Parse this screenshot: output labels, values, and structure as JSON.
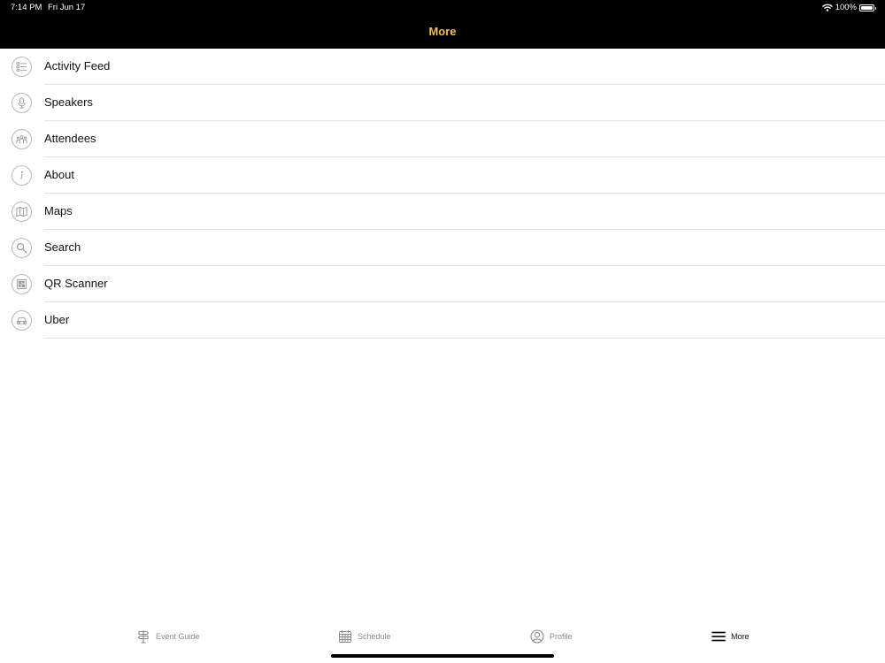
{
  "status_bar": {
    "time": "7:14 PM",
    "date": "Fri Jun 17",
    "battery": "100%"
  },
  "nav": {
    "title": "More"
  },
  "menu": {
    "items": [
      {
        "label": "Activity Feed",
        "icon": "activity-feed-icon"
      },
      {
        "label": "Speakers",
        "icon": "microphone-icon"
      },
      {
        "label": "Attendees",
        "icon": "attendees-icon"
      },
      {
        "label": "About",
        "icon": "info-icon"
      },
      {
        "label": "Maps",
        "icon": "map-icon"
      },
      {
        "label": "Search",
        "icon": "search-icon"
      },
      {
        "label": "QR Scanner",
        "icon": "qr-code-icon"
      },
      {
        "label": "Uber",
        "icon": "car-icon"
      }
    ]
  },
  "tabs": [
    {
      "label": "Event Guide",
      "icon": "signpost-icon"
    },
    {
      "label": "Schedule",
      "icon": "calendar-icon"
    },
    {
      "label": "Profile",
      "icon": "profile-icon"
    },
    {
      "label": "More",
      "icon": "hamburger-menu-icon",
      "active": true
    }
  ],
  "colors": {
    "accent": "#f0c040",
    "nav_background": "#000000",
    "divider": "#e2e2e2",
    "icon_gray": "#8a8a8a"
  }
}
